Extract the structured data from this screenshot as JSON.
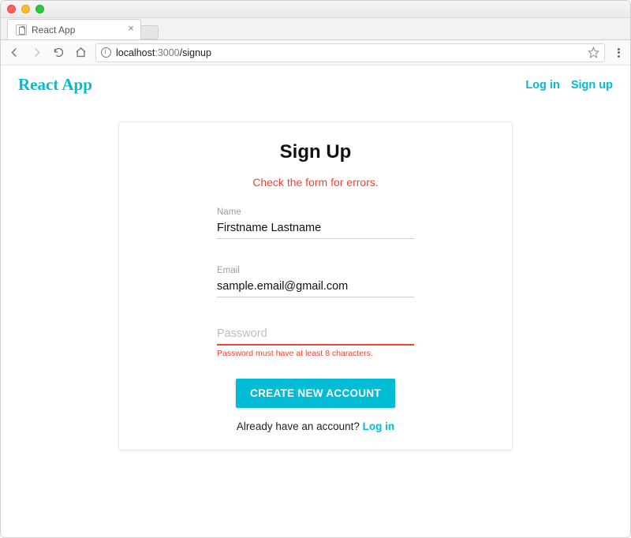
{
  "browser": {
    "tab_title": "React App",
    "url_host": "localhost",
    "url_port": ":3000",
    "url_path": "/signup"
  },
  "appbar": {
    "brand": "React App",
    "login_label": "Log in",
    "signup_label": "Sign up"
  },
  "form": {
    "title": "Sign Up",
    "error_summary": "Check the form for errors.",
    "name": {
      "label": "Name",
      "value": "Firstname Lastname"
    },
    "email": {
      "label": "Email",
      "value": "sample.email@gmail.com"
    },
    "password": {
      "label": "Password",
      "placeholder": "Password",
      "value": "",
      "error": "Password must have at least 8 characters."
    },
    "submit_label": "CREATE NEW ACCOUNT",
    "already_text": "Already have an account? ",
    "already_link": "Log in"
  }
}
